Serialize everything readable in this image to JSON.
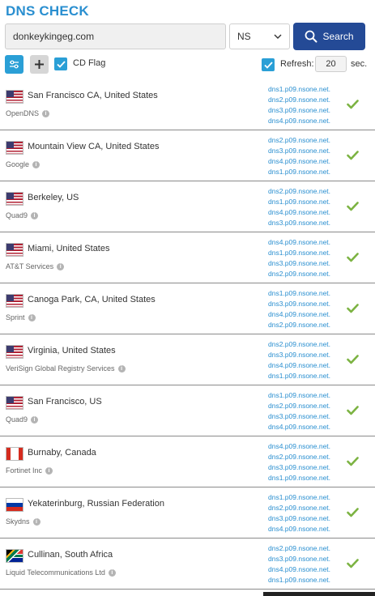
{
  "title": "DNS CHECK",
  "search": {
    "domain": "donkeykingeg.com",
    "record_type": "NS",
    "button_label": "Search"
  },
  "toolbar": {
    "cd_flag_label": "CD Flag",
    "refresh_label": "Refresh:",
    "refresh_value": "20",
    "refresh_unit": "sec."
  },
  "colors": {
    "accent": "#2a8fd0",
    "button": "#244a96",
    "ok": "#7cb342"
  },
  "results": [
    {
      "flag": "us",
      "location": "San Francisco CA, United States",
      "provider": "OpenDNS",
      "ns": [
        "dns1.p09.nsone.net.",
        "dns2.p09.nsone.net.",
        "dns3.p09.nsone.net.",
        "dns4.p09.nsone.net."
      ],
      "status_icon": "check-icon"
    },
    {
      "flag": "us",
      "location": "Mountain View CA, United States",
      "provider": "Google",
      "ns": [
        "dns2.p09.nsone.net.",
        "dns3.p09.nsone.net.",
        "dns4.p09.nsone.net.",
        "dns1.p09.nsone.net."
      ],
      "status_icon": "check-icon"
    },
    {
      "flag": "us",
      "location": "Berkeley, US",
      "provider": "Quad9",
      "ns": [
        "dns2.p09.nsone.net.",
        "dns1.p09.nsone.net.",
        "dns4.p09.nsone.net.",
        "dns3.p09.nsone.net."
      ],
      "status_icon": "check-icon"
    },
    {
      "flag": "us",
      "location": "Miami, United States",
      "provider": "AT&T Services",
      "ns": [
        "dns4.p09.nsone.net.",
        "dns1.p09.nsone.net.",
        "dns3.p09.nsone.net.",
        "dns2.p09.nsone.net."
      ],
      "status_icon": "check-icon"
    },
    {
      "flag": "us",
      "location": "Canoga Park, CA, United States",
      "provider": "Sprint",
      "ns": [
        "dns1.p09.nsone.net.",
        "dns3.p09.nsone.net.",
        "dns4.p09.nsone.net.",
        "dns2.p09.nsone.net."
      ],
      "status_icon": "check-icon"
    },
    {
      "flag": "us",
      "location": "Virginia, United States",
      "provider": "VeriSign Global Registry Services",
      "ns": [
        "dns2.p09.nsone.net.",
        "dns3.p09.nsone.net.",
        "dns4.p09.nsone.net.",
        "dns1.p09.nsone.net."
      ],
      "status_icon": "check-icon"
    },
    {
      "flag": "us",
      "location": "San Francisco, US",
      "provider": "Quad9",
      "ns": [
        "dns1.p09.nsone.net.",
        "dns2.p09.nsone.net.",
        "dns3.p09.nsone.net.",
        "dns4.p09.nsone.net."
      ],
      "status_icon": "check-icon"
    },
    {
      "flag": "ca",
      "location": "Burnaby, Canada",
      "provider": "Fortinet Inc",
      "ns": [
        "dns4.p09.nsone.net.",
        "dns2.p09.nsone.net.",
        "dns3.p09.nsone.net.",
        "dns1.p09.nsone.net."
      ],
      "status_icon": "check-icon"
    },
    {
      "flag": "ru",
      "location": "Yekaterinburg, Russian Federation",
      "provider": "Skydns",
      "ns": [
        "dns1.p09.nsone.net.",
        "dns2.p09.nsone.net.",
        "dns3.p09.nsone.net.",
        "dns4.p09.nsone.net."
      ],
      "status_icon": "check-icon"
    },
    {
      "flag": "za",
      "location": "Cullinan, South Africa",
      "provider": "Liquid Telecommunications Ltd",
      "ns": [
        "dns2.p09.nsone.net.",
        "dns3.p09.nsone.net.",
        "dns4.p09.nsone.net.",
        "dns1.p09.nsone.net."
      ],
      "status_icon": "check-icon"
    }
  ]
}
